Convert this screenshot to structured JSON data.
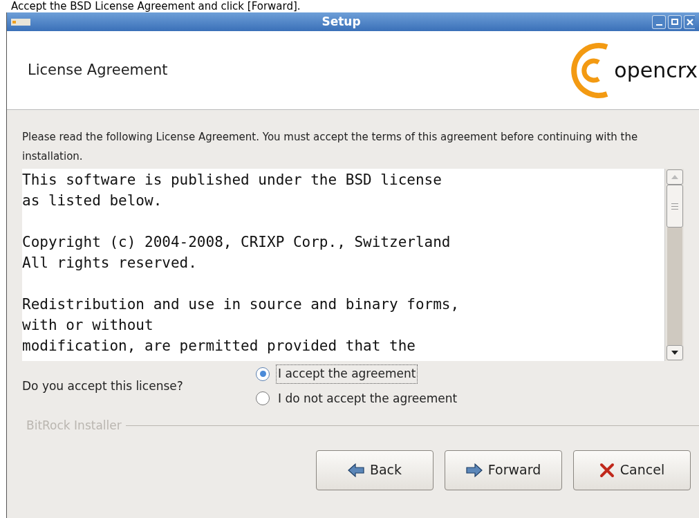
{
  "caption": "Accept the BSD License Agreement and click [Forward].",
  "window": {
    "title": "Setup"
  },
  "header": {
    "title": "License Agreement",
    "logo_text": "opencrx"
  },
  "intro": "Please read the following License Agreement. You must accept the terms of this agreement before continuing with the installation.",
  "license_paragraphs": [
    [
      "This software is published under the BSD license",
      "as listed below."
    ],
    [
      "Copyright (c) 2004-2008, CRIXP Corp., Switzerland",
      "All rights reserved."
    ],
    [
      "Redistribution and use in source and binary forms,",
      "with or without",
      "modification, are permitted provided that the"
    ]
  ],
  "question": "Do you accept this license?",
  "options": [
    {
      "label": "I accept the agreement",
      "selected": true
    },
    {
      "label": "I do not accept the agreement",
      "selected": false
    }
  ],
  "footer_label": "BitRock Installer",
  "buttons": [
    {
      "kind": "back",
      "label": "Back"
    },
    {
      "kind": "forward",
      "label": "Forward"
    },
    {
      "kind": "cancel",
      "label": "Cancel"
    }
  ]
}
